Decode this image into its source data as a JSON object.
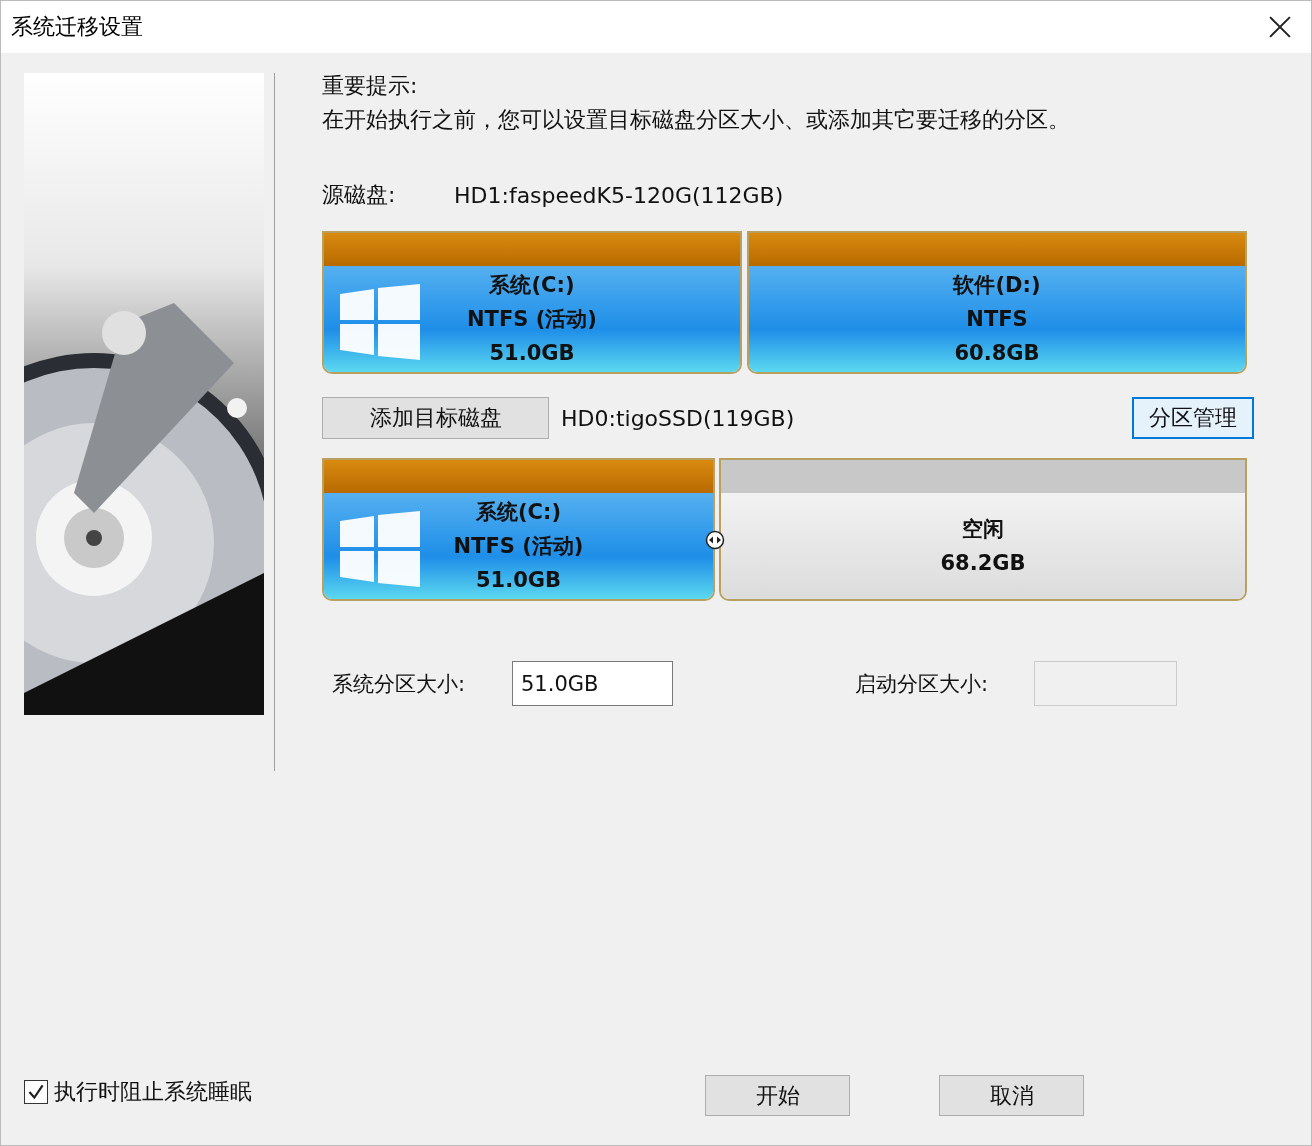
{
  "window": {
    "title": "系统迁移设置"
  },
  "notice": {
    "heading": "重要提示:",
    "text": "在开始执行之前，您可以设置目标磁盘分区大小、或添加其它要迁移的分区。"
  },
  "source_disk": {
    "label": "源磁盘:",
    "name": "HD1:faspeedK5-120G(112GB)",
    "partitions": [
      {
        "kind": "system",
        "name": "系统(C:)",
        "fs": "NTFS (活动)",
        "size": "51.0GB"
      },
      {
        "kind": "data",
        "name": "软件(D:)",
        "fs": "NTFS",
        "size": "60.8GB"
      }
    ]
  },
  "target_disk": {
    "add_button": "添加目标磁盘",
    "name": "HD0:tigoSSD(119GB)",
    "manage_button": "分区管理",
    "partitions": [
      {
        "kind": "system",
        "name": "系统(C:)",
        "fs": "NTFS (活动)",
        "size": "51.0GB"
      },
      {
        "kind": "free",
        "name": "空闲",
        "size": "68.2GB"
      }
    ]
  },
  "fields": [
    {
      "label": "系统分区大小:",
      "value": "51.0GB",
      "disabled": false
    },
    {
      "label": "启动分区大小:",
      "disabled": true
    }
  ],
  "prevent_sleep": {
    "label": "执行时阻止系统睡眠",
    "checked": true
  },
  "buttons": [
    "开始",
    "取消"
  ]
}
